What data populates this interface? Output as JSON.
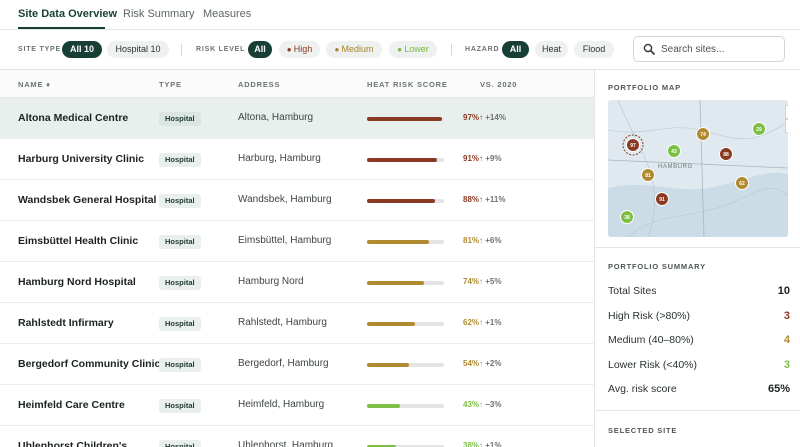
{
  "tabs": [
    {
      "label": "Site Data Overview",
      "active": true
    },
    {
      "label": "Risk Summary",
      "active": false
    },
    {
      "label": "Measures",
      "active": false
    }
  ],
  "filters": {
    "site_type_label": "SITE TYPE",
    "site_type_options": [
      "All 10",
      "Hospital 10"
    ],
    "risk_level_label": "RISK LEVEL",
    "risk_level_options": [
      "All",
      "High",
      "Medium",
      "Lower"
    ],
    "hazard_label": "HAZARD",
    "hazard_options": [
      "All",
      "Heat",
      "Flood"
    ],
    "search_placeholder": "Search sites..."
  },
  "table": {
    "headers": {
      "name": "NAME ♦",
      "type": "TYPE",
      "address": "ADDRESS",
      "score": "HEAT RISK SCORE",
      "vs": "VS. 2020"
    },
    "rows": [
      {
        "name": "Altona Medical Centre",
        "type": "Hospital",
        "address": "Altona, Hamburg",
        "score": 97,
        "score_text": "97%↑",
        "delta": "+14%",
        "level": "high",
        "selected": true
      },
      {
        "name": "Harburg University Clinic",
        "type": "Hospital",
        "address": "Harburg, Hamburg",
        "score": 91,
        "score_text": "91%↑",
        "delta": "+9%",
        "level": "high",
        "selected": false
      },
      {
        "name": "Wandsbek General Hospital",
        "type": "Hospital",
        "address": "Wandsbek, Hamburg",
        "score": 88,
        "score_text": "88%↑",
        "delta": "+11%",
        "level": "high",
        "selected": false
      },
      {
        "name": "Eimsbüttel Health Clinic",
        "type": "Hospital",
        "address": "Eimsbüttel, Hamburg",
        "score": 81,
        "score_text": "81%↑",
        "delta": "+6%",
        "level": "medium",
        "selected": false
      },
      {
        "name": "Hamburg Nord Hospital",
        "type": "Hospital",
        "address": "Hamburg Nord",
        "score": 74,
        "score_text": "74%↑",
        "delta": "+5%",
        "level": "medium",
        "selected": false
      },
      {
        "name": "Rahlstedt Infirmary",
        "type": "Hospital",
        "address": "Rahlstedt, Hamburg",
        "score": 62,
        "score_text": "62%↑",
        "delta": "+1%",
        "level": "medium",
        "selected": false
      },
      {
        "name": "Bergedorf Community Clinic",
        "type": "Hospital",
        "address": "Bergedorf, Hamburg",
        "score": 54,
        "score_text": "54%↑",
        "delta": "+2%",
        "level": "medium",
        "selected": false
      },
      {
        "name": "Heimfeld Care Centre",
        "type": "Hospital",
        "address": "Heimfeld, Hamburg",
        "score": 43,
        "score_text": "43%↑",
        "delta": "−3%",
        "level": "low",
        "selected": false
      },
      {
        "name": "Uhlenhorst Children's",
        "type": "Hospital",
        "address": "Uhlenhorst, Hamburg",
        "score": 38,
        "score_text": "38%↑",
        "delta": "+1%",
        "level": "low",
        "selected": false
      }
    ]
  },
  "colors": {
    "high": "#8b3a22",
    "medium": "#b08a30",
    "low": "#7cbf45",
    "brand": "#173f35"
  },
  "map": {
    "title": "PORTFOLIO MAP",
    "city_label": "HAMBURG",
    "zoom_in": "+",
    "zoom_out": "−",
    "pins": [
      {
        "label": "97",
        "level": "high",
        "selected": true
      },
      {
        "label": "74",
        "level": "medium"
      },
      {
        "label": "43",
        "level": "low"
      },
      {
        "label": "88",
        "level": "high"
      },
      {
        "label": "29",
        "level": "low"
      },
      {
        "label": "81",
        "level": "medium"
      },
      {
        "label": "91",
        "level": "high"
      },
      {
        "label": "62",
        "level": "medium"
      },
      {
        "label": "38",
        "level": "low"
      }
    ]
  },
  "summary": {
    "title": "PORTFOLIO SUMMARY",
    "items": [
      {
        "label": "Total Sites",
        "value": "10",
        "level": "neutral"
      },
      {
        "label": "High Risk (>80%)",
        "value": "3",
        "level": "high"
      },
      {
        "label": "Medium (40–80%)",
        "value": "4",
        "level": "medium"
      },
      {
        "label": "Lower Risk (<40%)",
        "value": "3",
        "level": "low"
      },
      {
        "label": "Avg. risk score",
        "value": "65%",
        "level": "neutral"
      }
    ]
  },
  "selected_site": {
    "title": "SELECTED SITE"
  }
}
